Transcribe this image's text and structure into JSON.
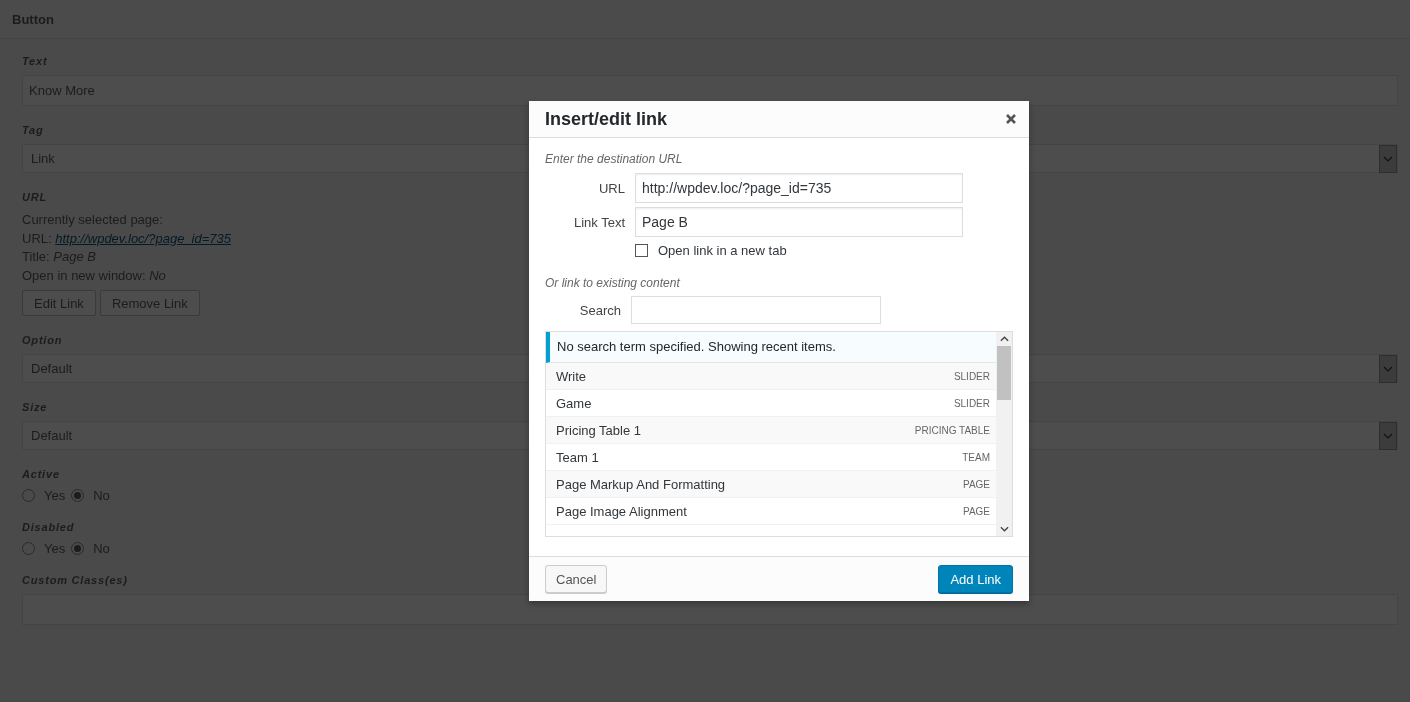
{
  "section_title": "Button",
  "fields": [
    {
      "kind": "text",
      "label": "Text",
      "value": "Know More"
    },
    {
      "kind": "select",
      "label": "Tag",
      "value": "Link"
    },
    {
      "kind": "link",
      "label": "URL",
      "intro": "Currently selected page:",
      "url_prefix": "URL:",
      "url": "http://wpdev.loc/?page_id=735",
      "lines": [
        "Title: *Page B*",
        "Open in new window: *No*"
      ],
      "buttons": [
        "Edit Link",
        "Remove Link"
      ]
    },
    {
      "kind": "select",
      "label": "Option",
      "value": "Default"
    },
    {
      "kind": "select",
      "label": "Size",
      "value": "Default"
    },
    {
      "kind": "radio",
      "label": "Active",
      "options": [
        {
          "label": "Yes",
          "selected": false
        },
        {
          "label": "No",
          "selected": true
        }
      ]
    },
    {
      "kind": "radio",
      "label": "Disabled",
      "options": [
        {
          "label": "Yes",
          "selected": false
        },
        {
          "label": "No",
          "selected": true
        }
      ]
    },
    {
      "kind": "text",
      "label": "Custom Class(es)"
    }
  ],
  "modal": {
    "title": "Insert/edit link",
    "url_hint": "Enter the destination URL",
    "inputs": [
      {
        "label": "URL",
        "value": "http://wpdev.loc/?page_id=735"
      },
      {
        "label": "Link Text",
        "value": "Page B"
      }
    ],
    "new_tab": {
      "label": "Open link in a new tab",
      "checked": false
    },
    "existing_hint": "Or link to existing content",
    "search": {
      "label": "Search"
    },
    "notice": "No search term specified. Showing recent items.",
    "items": [
      {
        "title": "Write",
        "type": "SLIDER"
      },
      {
        "title": "Game",
        "type": "SLIDER"
      },
      {
        "title": "Pricing Table 1",
        "type": "PRICING TABLE"
      },
      {
        "title": "Team 1",
        "type": "TEAM"
      },
      {
        "title": "Page Markup And Formatting",
        "type": "PAGE"
      },
      {
        "title": "Page Image Alignment",
        "type": "PAGE"
      }
    ],
    "cancel": "Cancel",
    "submit": "Add Link"
  }
}
